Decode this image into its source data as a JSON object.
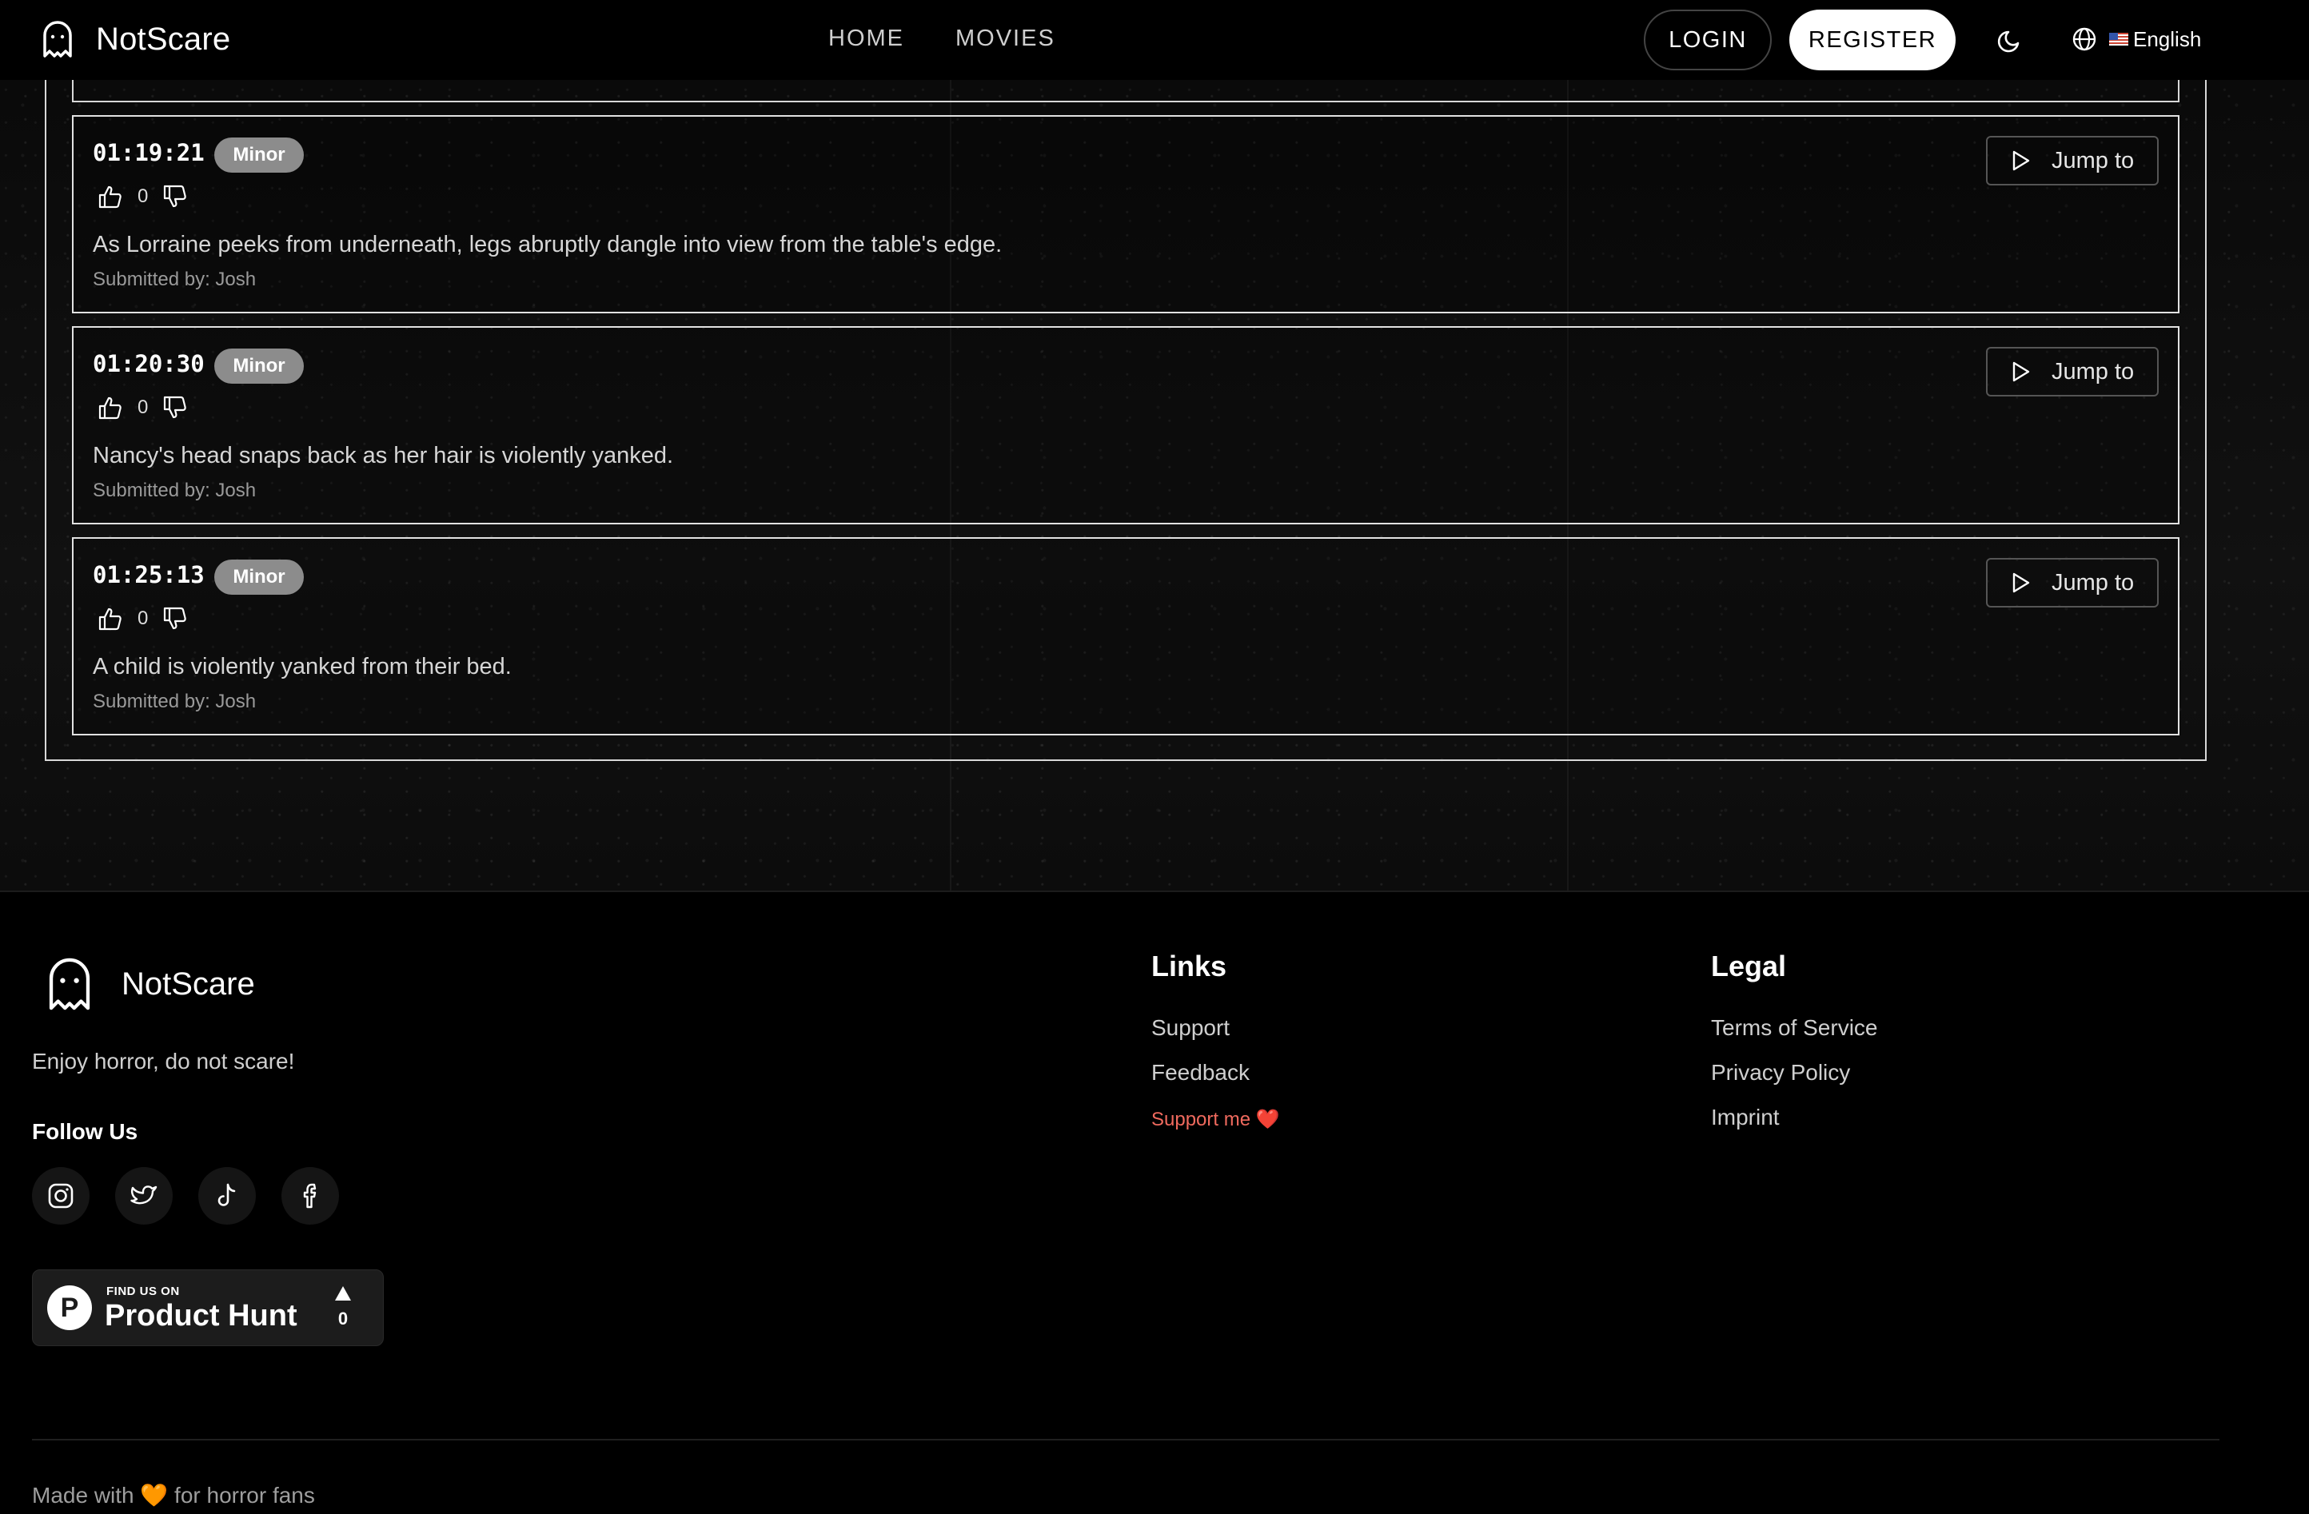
{
  "nav": {
    "brand": "NotScare",
    "links": [
      "HOME",
      "MOVIES"
    ],
    "login": "LOGIN",
    "register": "REGISTER",
    "language": "English",
    "theme_icon": "moon-icon",
    "language_icon": "globe-icon"
  },
  "scenes": [
    {
      "time": "01:19:21",
      "severity": "Minor",
      "votes": "0",
      "description": "As Lorraine peeks from underneath, legs abruptly dangle into view from the table's edge.",
      "submitted": "Submitted by: Josh",
      "jump": "Jump to"
    },
    {
      "time": "01:20:30",
      "severity": "Minor",
      "votes": "0",
      "description": "Nancy's head snaps back as her hair is violently yanked.",
      "submitted": "Submitted by: Josh",
      "jump": "Jump to"
    },
    {
      "time": "01:25:13",
      "severity": "Minor",
      "votes": "0",
      "description": "A child is violently yanked from their bed.",
      "submitted": "Submitted by: Josh",
      "jump": "Jump to"
    }
  ],
  "footer": {
    "brand": "NotScare",
    "tagline": "Enjoy horror, do not scare!",
    "follow": "Follow Us",
    "socials": [
      "instagram-icon",
      "twitter-icon",
      "tiktok-icon",
      "facebook-icon"
    ],
    "producthunt": {
      "small": "FIND US ON",
      "big": "Product Hunt",
      "logo": "P",
      "count": "0"
    },
    "links_title": "Links",
    "links": [
      "Support",
      "Feedback",
      "Support me ❤️"
    ],
    "legal_title": "Legal",
    "legal": [
      "Terms of Service",
      "Privacy Policy",
      "Imprint"
    ],
    "madewith": "Made with 🧡 for horror fans"
  },
  "colors": {
    "background": "#000000",
    "badge": "#8c8c8c",
    "support_link": "#f06a5e"
  }
}
